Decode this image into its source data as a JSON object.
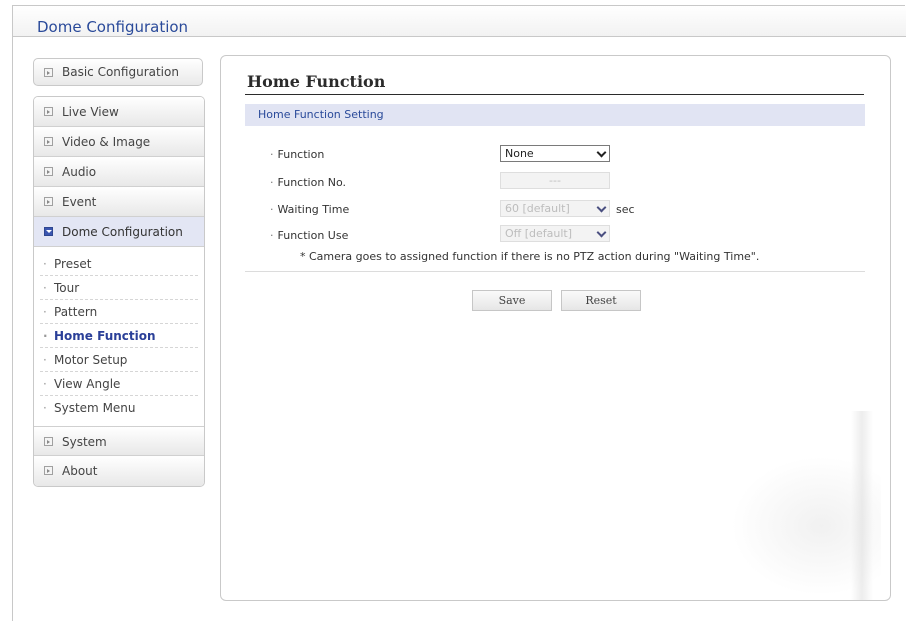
{
  "app": {
    "title": "Dome Configuration"
  },
  "sidebar": {
    "basic": {
      "label": "Basic Configuration",
      "icon": "expand-box-icon"
    },
    "items": [
      {
        "label": "Live View",
        "icon": "expand-box-icon"
      },
      {
        "label": "Video & Image",
        "icon": "expand-box-icon"
      },
      {
        "label": "Audio",
        "icon": "expand-box-icon"
      },
      {
        "label": "Event",
        "icon": "expand-box-icon"
      },
      {
        "label": "Dome Configuration",
        "icon": "collapse-box-icon",
        "active": true
      },
      {
        "label": "System",
        "icon": "expand-box-icon"
      },
      {
        "label": "About",
        "icon": "expand-box-icon"
      }
    ],
    "submenu": [
      {
        "label": "Preset"
      },
      {
        "label": "Tour"
      },
      {
        "label": "Pattern"
      },
      {
        "label": "Home Function",
        "current": true
      },
      {
        "label": "Motor Setup"
      },
      {
        "label": "View Angle"
      },
      {
        "label": "System Menu"
      }
    ]
  },
  "main": {
    "title": "Home Function",
    "section": "Home Function Setting",
    "fields": {
      "function": {
        "label": "Function",
        "value": "None",
        "enabled": true
      },
      "function_no": {
        "label": "Function No.",
        "value": "---",
        "enabled": false
      },
      "waiting_time": {
        "label": "Waiting Time",
        "value": "60 [default]",
        "unit": "sec",
        "enabled": false
      },
      "function_use": {
        "label": "Function Use",
        "value": "Off [default]",
        "enabled": false
      }
    },
    "note": "* Camera goes to assigned function if there is no PTZ action during \"Waiting Time\".",
    "buttons": {
      "save": "Save",
      "reset": "Reset"
    }
  },
  "colors": {
    "accent": "#2a4a9a",
    "section_bg": "#e1e4f3",
    "active_menu_bg": "#e3e6f4"
  }
}
